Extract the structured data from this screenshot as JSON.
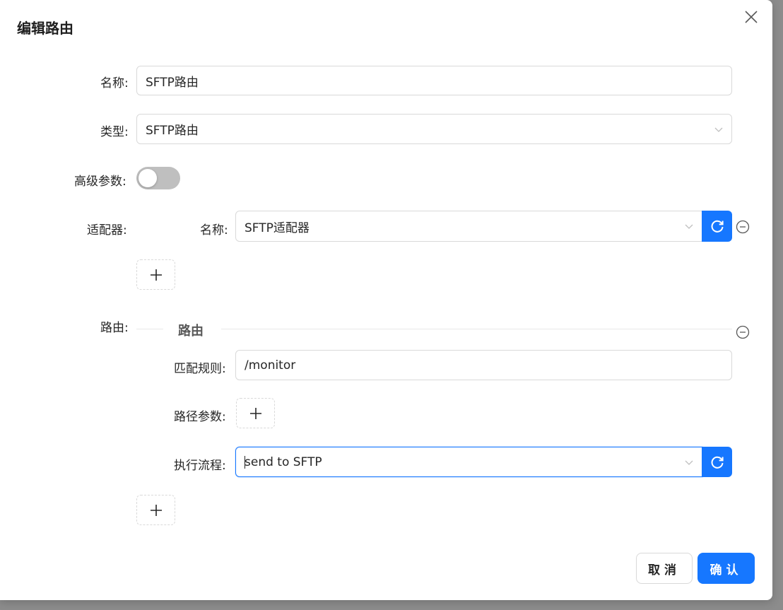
{
  "dialog": {
    "title": "编辑路由"
  },
  "form": {
    "name_label": "名称:",
    "name_value": "SFTP路由",
    "type_label": "类型:",
    "type_value": "SFTP路由",
    "advanced_label": "高级参数:",
    "advanced_enabled": false,
    "adapter_label": "适配器:",
    "adapter_name_label": "名称:",
    "adapter_name_value": "SFTP适配器",
    "route_label": "路由:",
    "route_divider_title": "路由",
    "match_rule_label": "匹配规则:",
    "match_rule_value": "/monitor",
    "path_params_label": "路径参数:",
    "flow_label": "执行流程:",
    "flow_value": "send to SFTP"
  },
  "footer": {
    "cancel_label": "取消",
    "ok_label": "确认"
  },
  "colors": {
    "primary": "#1677ff",
    "border": "#d9d9d9",
    "switch_off": "#bfbfbf"
  },
  "icons": [
    "close-icon",
    "chevron-down-icon",
    "refresh-icon",
    "minus-circle-icon",
    "plus-icon"
  ]
}
